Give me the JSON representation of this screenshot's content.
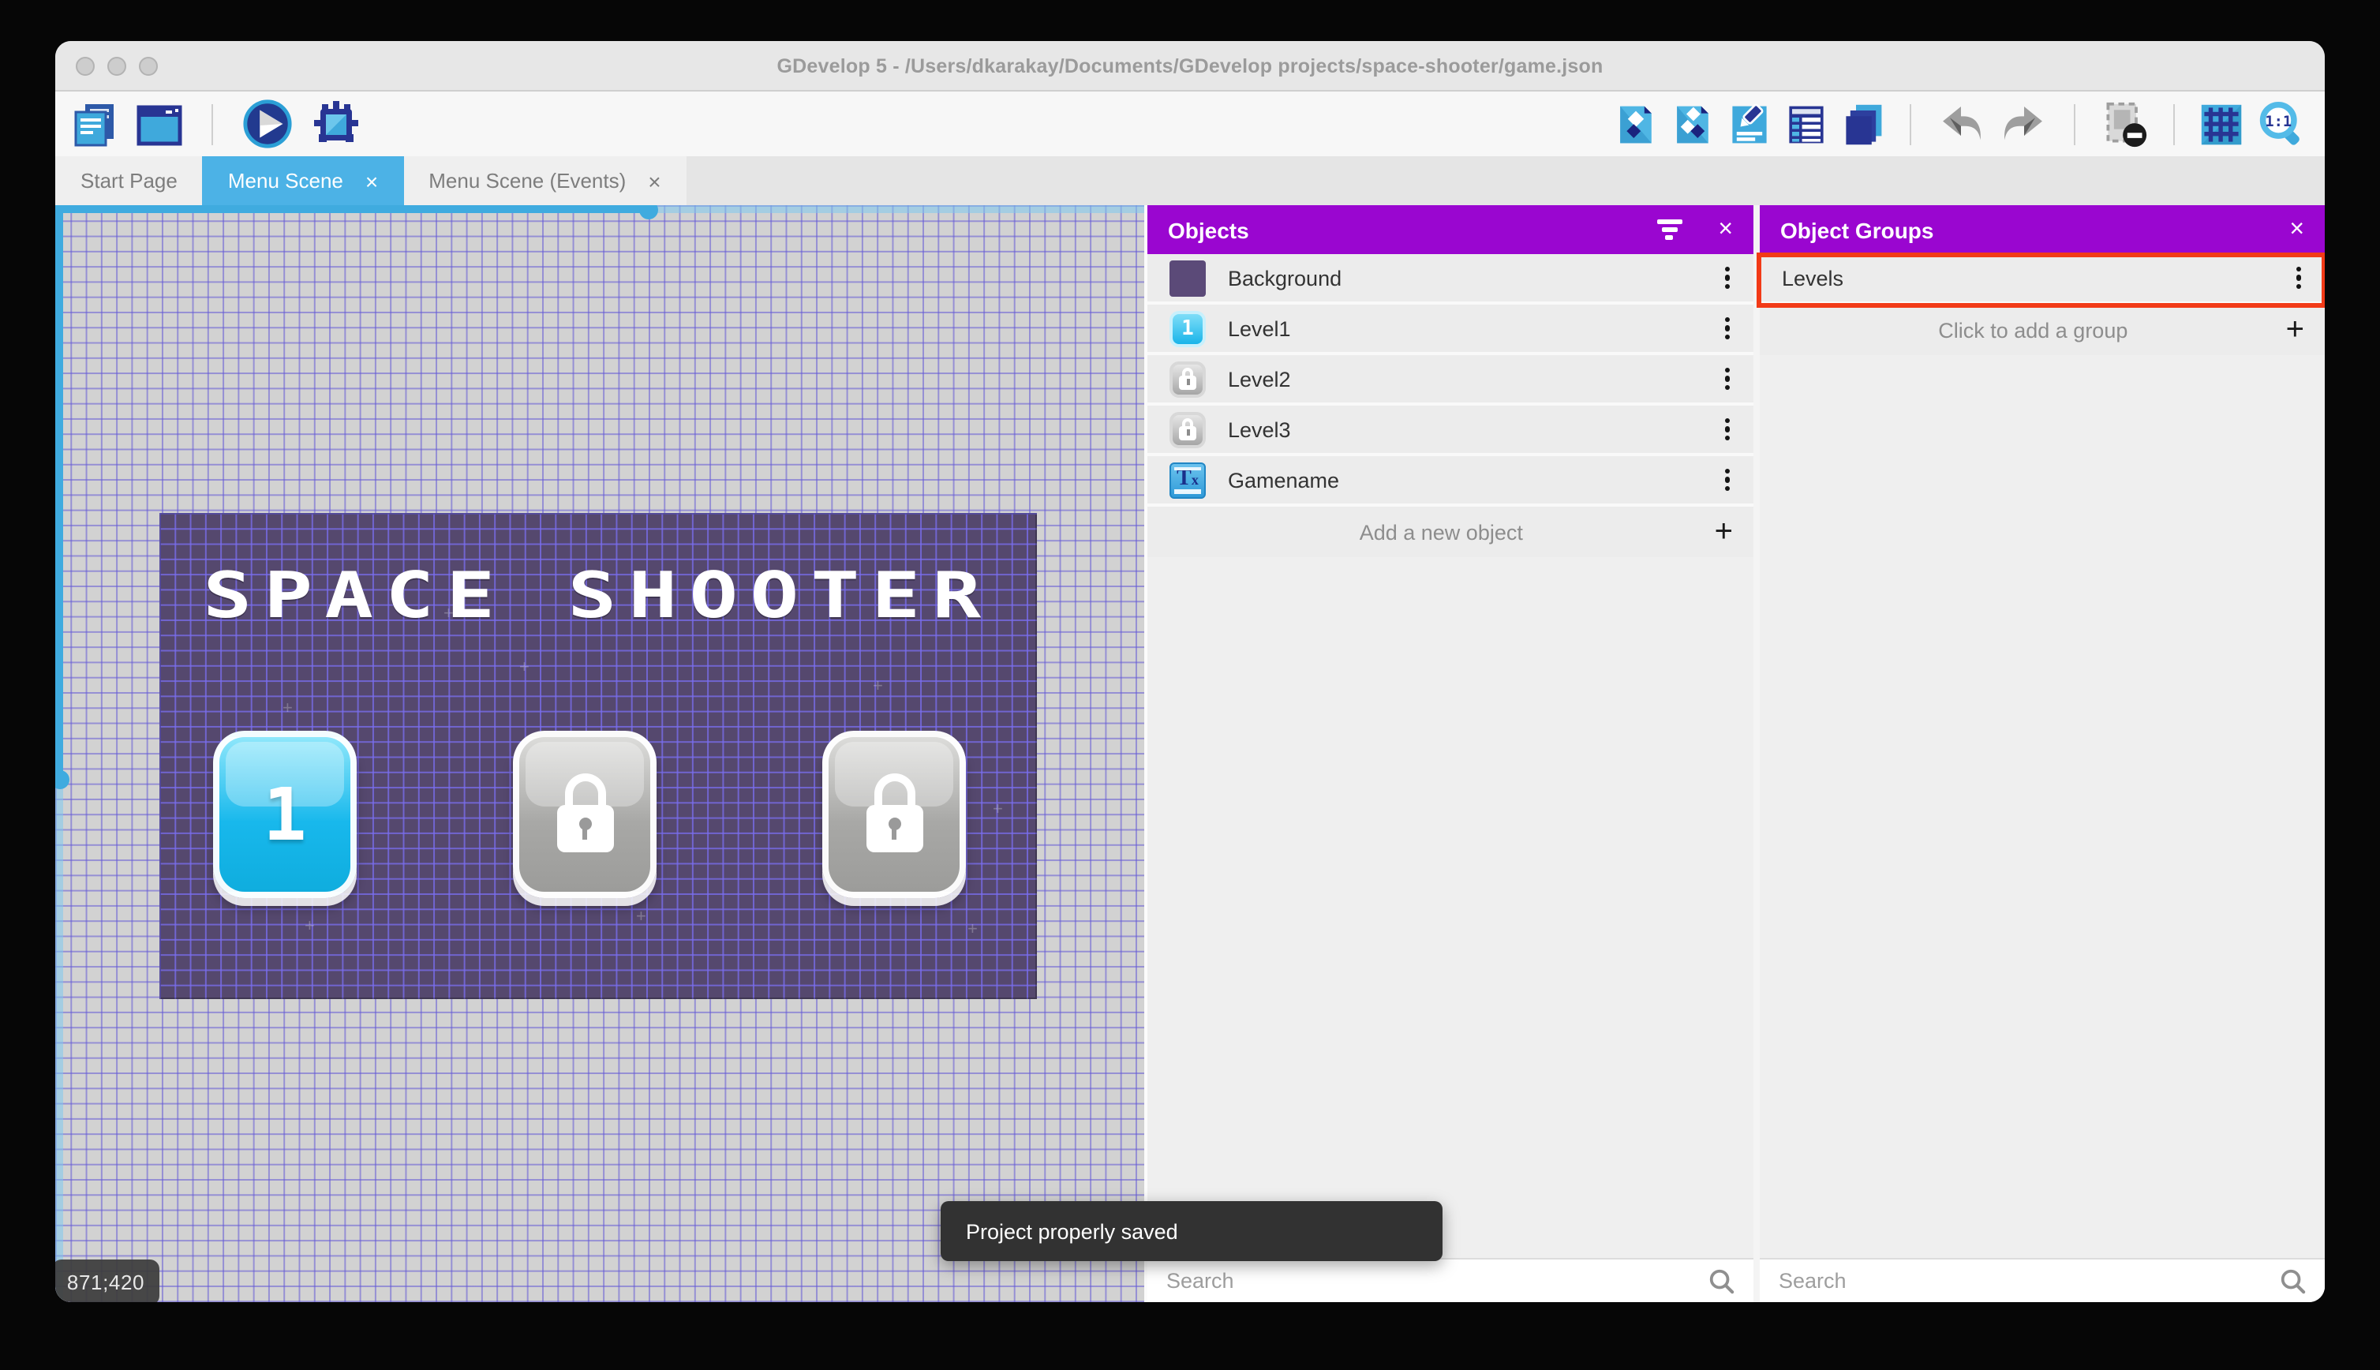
{
  "window": {
    "title": "GDevelop 5 - /Users/dkarakay/Documents/GDevelop projects/space-shooter/game.json"
  },
  "toolbar": {
    "left_icons": [
      "project-manager",
      "scene-window",
      "play",
      "debug"
    ],
    "right_icons": [
      "objects-editor",
      "object-groups-editor",
      "properties",
      "instances-list",
      "layers",
      "undo",
      "redo",
      "mask",
      "grid",
      "zoom-1-1"
    ]
  },
  "tabs": [
    {
      "label": "Start Page",
      "active": false,
      "closable": false
    },
    {
      "label": "Menu Scene",
      "active": true,
      "closable": true
    },
    {
      "label": "Menu Scene (Events)",
      "active": false,
      "closable": true
    }
  ],
  "canvas": {
    "scene_title": "SPACE SHOOTER",
    "level_buttons": [
      {
        "label": "1",
        "locked": false
      },
      {
        "label": "",
        "locked": true
      },
      {
        "label": "",
        "locked": true
      }
    ],
    "cursor_coordinates": "871;420"
  },
  "toast": {
    "message": "Project properly saved"
  },
  "objects_panel": {
    "title": "Objects",
    "items": [
      {
        "label": "Background",
        "icon": "purple-square"
      },
      {
        "label": "Level1",
        "icon": "level1-button"
      },
      {
        "label": "Level2",
        "icon": "locked-button"
      },
      {
        "label": "Level3",
        "icon": "locked-button"
      },
      {
        "label": "Gamename",
        "icon": "text-object"
      }
    ],
    "add_label": "Add a new object",
    "search_placeholder": "Search"
  },
  "groups_panel": {
    "title": "Object Groups",
    "items": [
      {
        "label": "Levels",
        "highlighted": true
      }
    ],
    "add_label": "Click to add a group",
    "search_placeholder": "Search"
  },
  "colors": {
    "accent_blue": "#4cb2e6",
    "header_purple": "#9a06d0",
    "highlight_red": "#f23a17",
    "toast_bg": "#323232",
    "scene_background": "#55486e"
  }
}
